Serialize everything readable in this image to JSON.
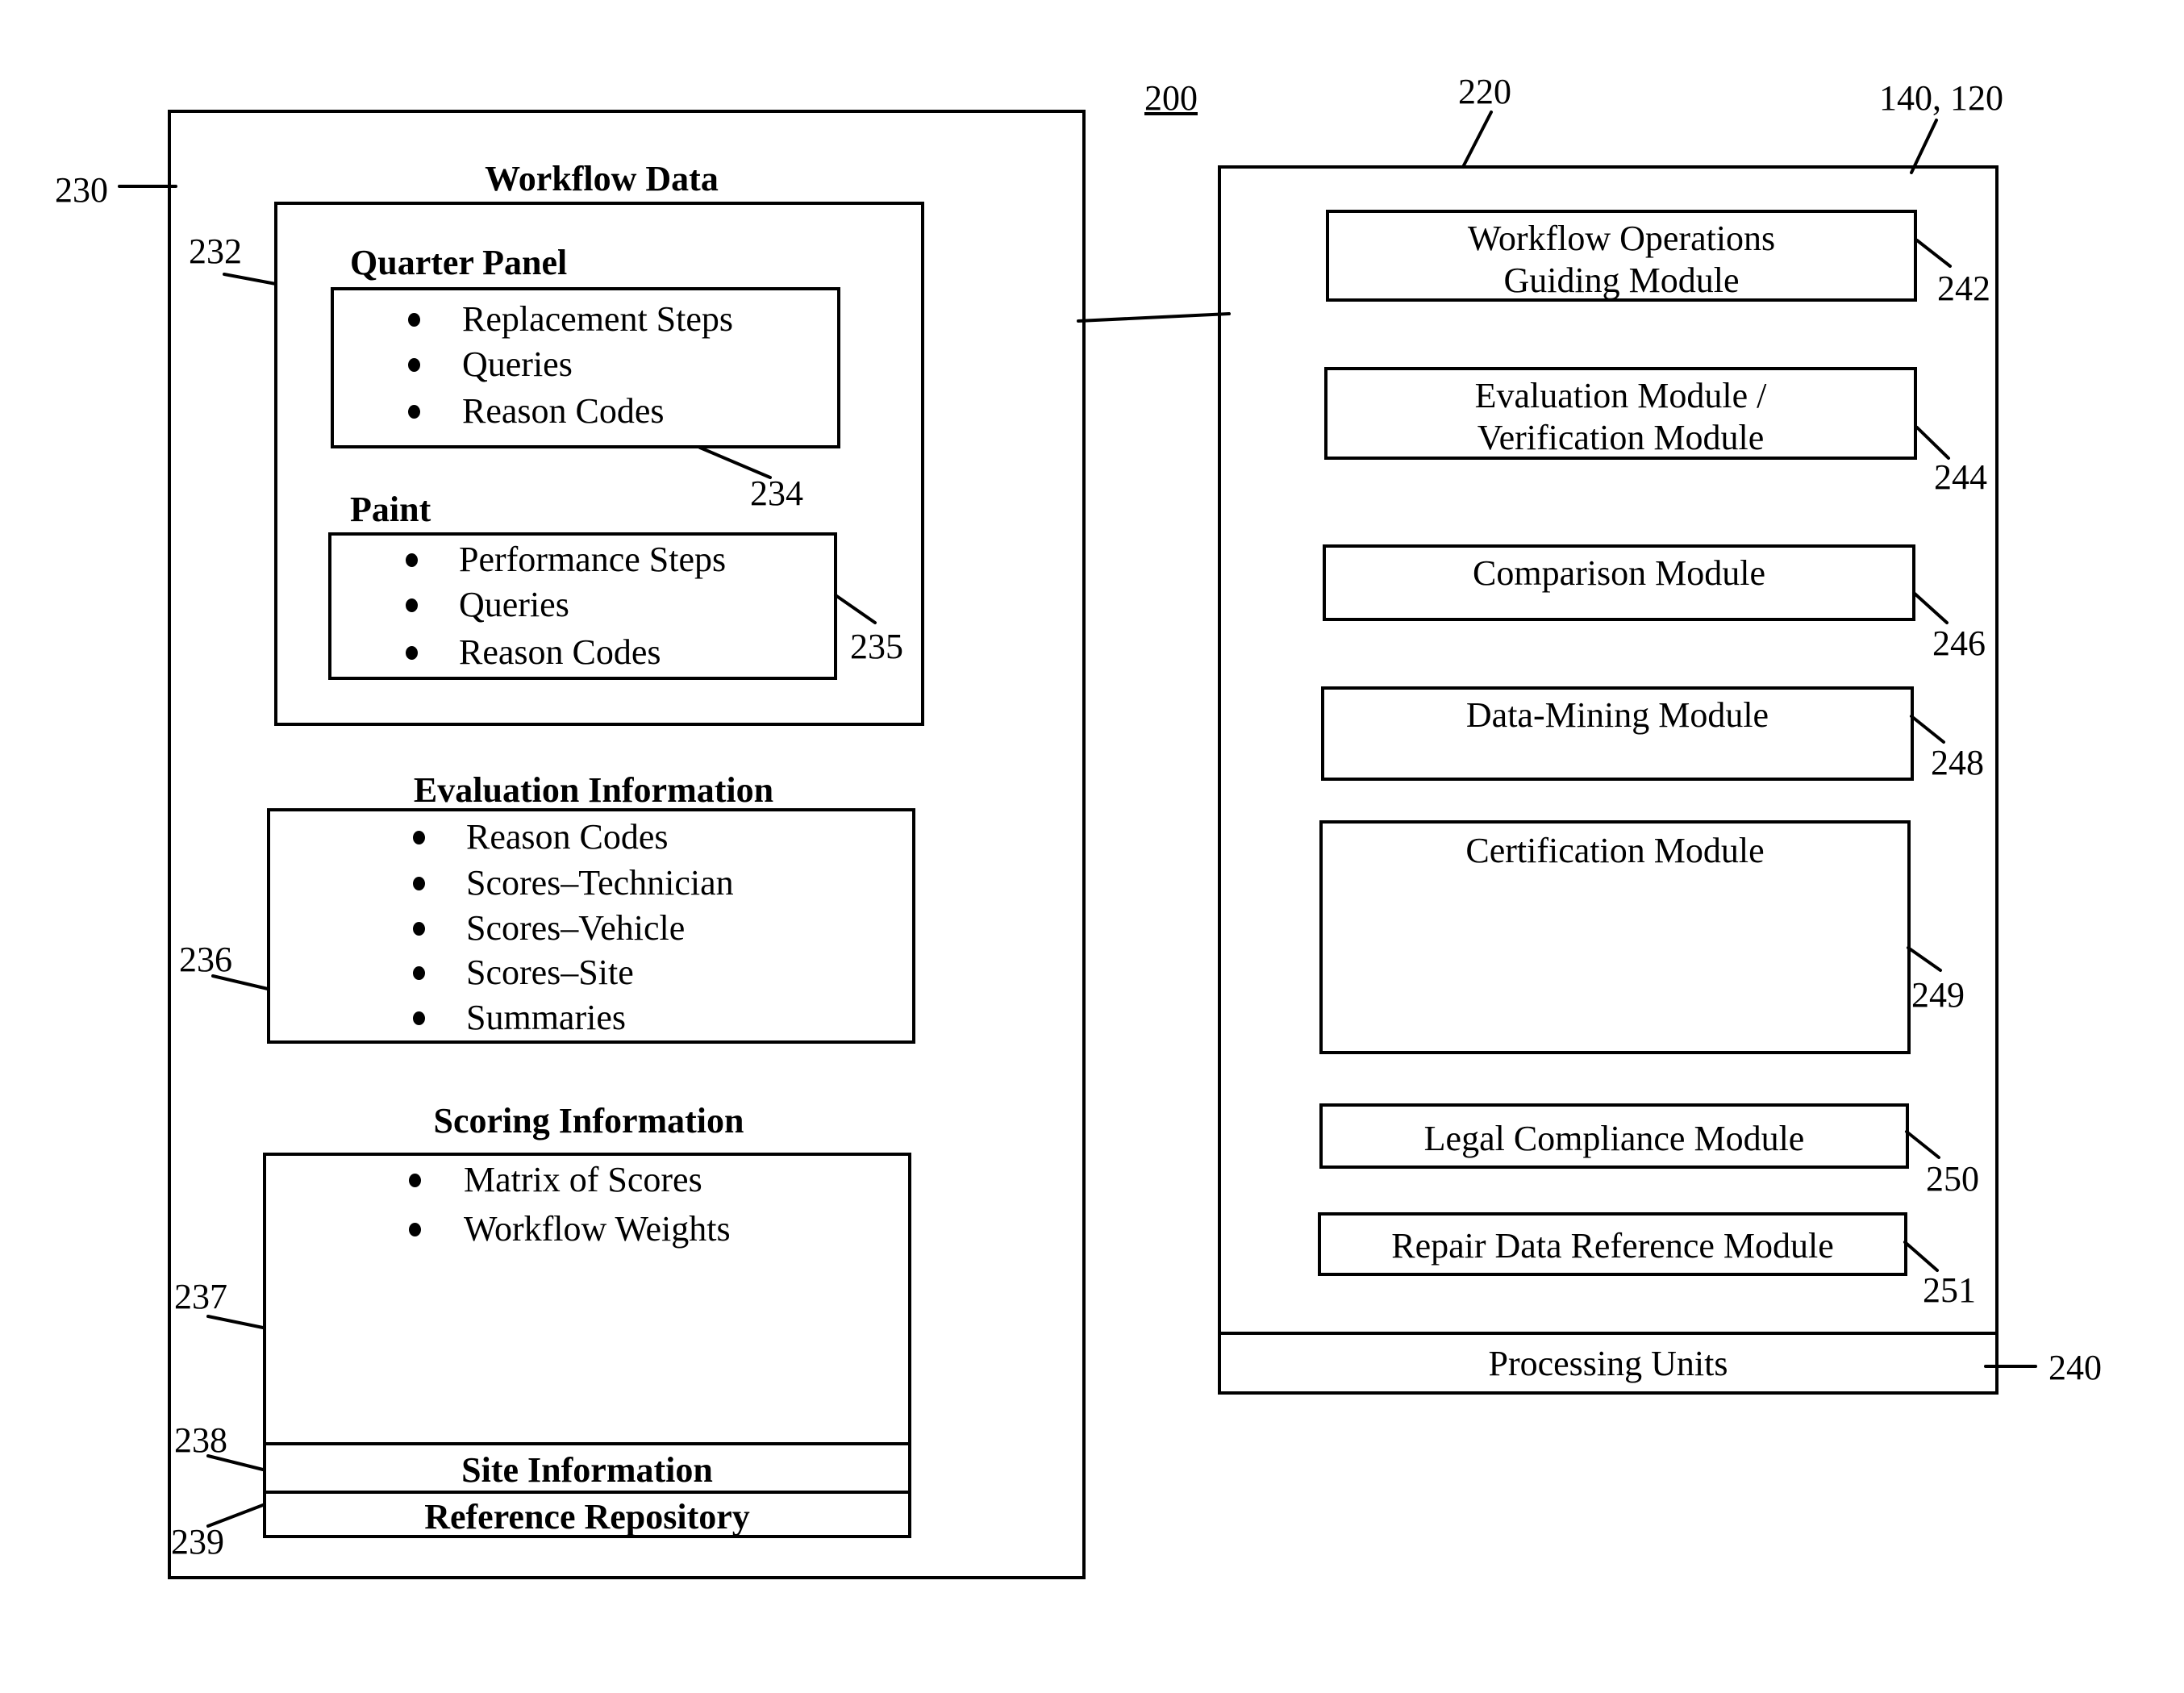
{
  "figure": {
    "number": "200",
    "left_panel": {
      "ref": "230",
      "title": "Workflow Data",
      "workflow_group": {
        "ref": "232",
        "sections": [
          {
            "title": "Quarter Panel",
            "ref": "234",
            "items": [
              "Replacement Steps",
              "Queries",
              "Reason Codes"
            ]
          },
          {
            "title": "Paint",
            "ref": "235",
            "items": [
              "Performance Steps",
              "Queries",
              "Reason Codes"
            ]
          }
        ]
      },
      "evaluation": {
        "title": "Evaluation Information",
        "ref": "236",
        "items": [
          "Reason Codes",
          "Scores–Technician",
          "Scores–Vehicle",
          "Scores–Site",
          "Summaries"
        ]
      },
      "scoring": {
        "title": "Scoring Information",
        "ref": "237",
        "items": [
          "Matrix of Scores",
          "Workflow Weights"
        ]
      },
      "site_information": {
        "label": "Site Information",
        "ref": "238"
      },
      "reference_repository": {
        "label": "Reference Repository",
        "ref": "239"
      }
    },
    "right_panel": {
      "ref_top": "220",
      "ref_system": "140, 120",
      "modules": [
        {
          "label_lines": [
            "Workflow Operations",
            "Guiding Module"
          ],
          "ref": "242"
        },
        {
          "label_lines": [
            "Evaluation Module /",
            "Verification Module"
          ],
          "ref": "244"
        },
        {
          "label_lines": [
            "Comparison Module"
          ],
          "ref": "246"
        },
        {
          "label_lines": [
            "Data-Mining Module"
          ],
          "ref": "248"
        },
        {
          "label_lines": [
            "Certification Module"
          ],
          "ref": "249"
        },
        {
          "label_lines": [
            "Legal Compliance Module"
          ],
          "ref": "250"
        },
        {
          "label_lines": [
            "Repair Data Reference Module"
          ],
          "ref": "251"
        }
      ],
      "processing_units": {
        "label": "Processing Units",
        "ref": "240"
      }
    }
  }
}
